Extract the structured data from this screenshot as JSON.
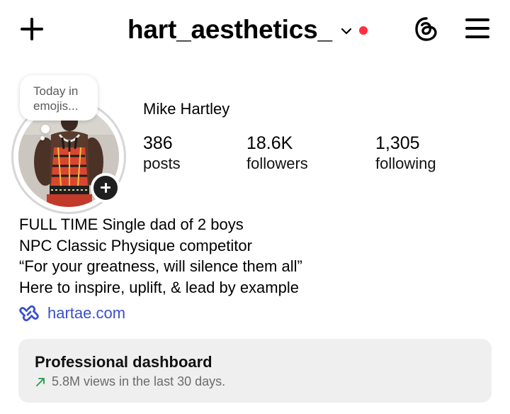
{
  "header": {
    "username": "hart_aesthetics_",
    "icons": {
      "create": "plus-icon",
      "account_switch": "chevron-down-icon",
      "threads": "threads-icon",
      "menu": "hamburger-menu-icon"
    },
    "notification_dot_color": "#ff3040"
  },
  "note": {
    "text": "Today in emojis..."
  },
  "profile": {
    "display_name": "Mike Hartley",
    "stats": [
      {
        "value": "386",
        "label": "posts"
      },
      {
        "value": "18.6K",
        "label": "followers"
      },
      {
        "value": "1,305",
        "label": "following"
      }
    ]
  },
  "bio": {
    "lines": [
      "FULL TIME Single dad of 2 boys",
      "NPC Classic Physique competitor",
      "“For your greatness, will silence them all”",
      "Here to inspire, uplift, & lead by example"
    ],
    "link": "hartae.com",
    "link_color": "#3a4fd0"
  },
  "dashboard": {
    "title": "Professional dashboard",
    "subtitle": "5.8M views in the last 30 days.",
    "trend_color": "#1f9d4a"
  }
}
